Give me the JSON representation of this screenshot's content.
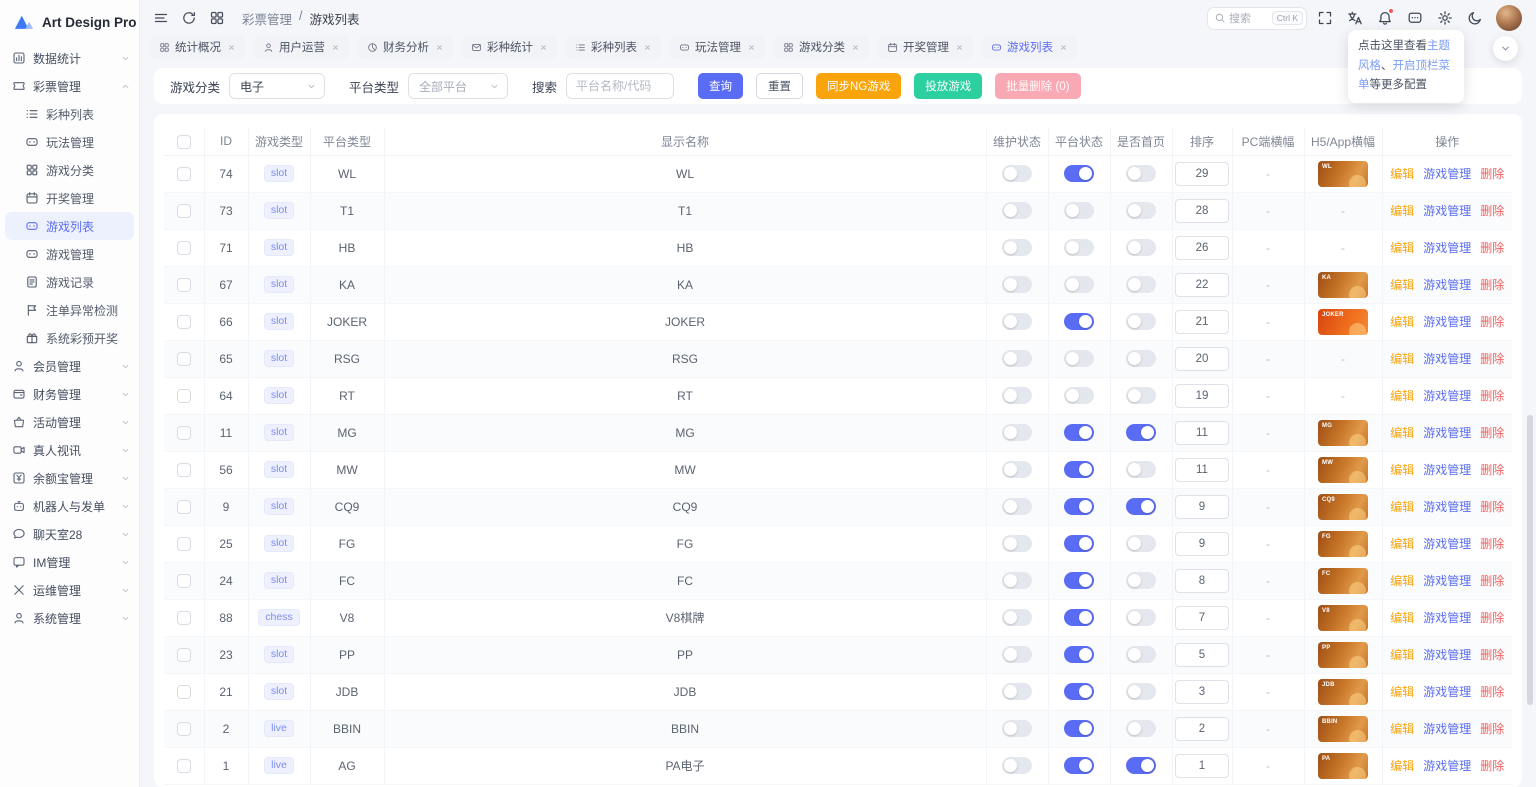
{
  "app": {
    "name": "Art Design Pro"
  },
  "topbar": {
    "breadcrumb": {
      "parent": "彩票管理",
      "separator": "/",
      "current": "游戏列表"
    },
    "search": {
      "placeholder": "搜索",
      "shortcut": "Ctrl K"
    }
  },
  "tooltip": {
    "line1_text": "点击这里查看",
    "line1_link": "主题风格",
    "line1_suffix": "、",
    "line2_link": "开启顶栏菜单",
    "line2_text": "等更多配置"
  },
  "tabs": [
    {
      "key": "stats-overview",
      "label": "统计概况",
      "icon": "grid",
      "active": false
    },
    {
      "key": "user-operation",
      "label": "用户运营",
      "icon": "user",
      "active": false
    },
    {
      "key": "finance-analysis",
      "label": "财务分析",
      "icon": "pie",
      "active": false
    },
    {
      "key": "lottery-stats",
      "label": "彩种统计",
      "icon": "mail",
      "active": false
    },
    {
      "key": "lottery-list",
      "label": "彩种列表",
      "icon": "list",
      "active": false
    },
    {
      "key": "play-manage",
      "label": "玩法管理",
      "icon": "gamepad",
      "active": false
    },
    {
      "key": "game-category",
      "label": "游戏分类",
      "icon": "grid",
      "active": false
    },
    {
      "key": "draw-manage",
      "label": "开奖管理",
      "icon": "calendar",
      "active": false
    },
    {
      "key": "game-list",
      "label": "游戏列表",
      "icon": "gamepad",
      "active": true
    }
  ],
  "sidebar": {
    "items": [
      {
        "key": "stats",
        "label": "数据统计",
        "icon": "bar-chart",
        "expanded": false
      },
      {
        "key": "lottery",
        "label": "彩票管理",
        "icon": "ticket",
        "expanded": true,
        "children": [
          {
            "key": "lottery-list",
            "label": "彩种列表",
            "icon": "list",
            "active": false
          },
          {
            "key": "play-manage",
            "label": "玩法管理",
            "icon": "gamepad",
            "active": false
          },
          {
            "key": "game-category",
            "label": "游戏分类",
            "icon": "grid",
            "active": false
          },
          {
            "key": "draw-manage",
            "label": "开奖管理",
            "icon": "calendar",
            "active": false
          },
          {
            "key": "game-list",
            "label": "游戏列表",
            "icon": "gamepad",
            "active": true
          },
          {
            "key": "game-manage",
            "label": "游戏管理",
            "icon": "gamepad",
            "active": false
          },
          {
            "key": "game-records",
            "label": "游戏记录",
            "icon": "document",
            "active": false
          },
          {
            "key": "bet-anomaly",
            "label": "注单异常检测",
            "icon": "alert-flag",
            "active": false
          },
          {
            "key": "system-predraw",
            "label": "系统彩预开奖",
            "icon": "gift",
            "active": false
          }
        ]
      },
      {
        "key": "members",
        "label": "会员管理",
        "icon": "user",
        "expanded": false
      },
      {
        "key": "finance",
        "label": "财务管理",
        "icon": "wallet",
        "expanded": false
      },
      {
        "key": "activity",
        "label": "活动管理",
        "icon": "activity",
        "expanded": false
      },
      {
        "key": "live-video",
        "label": "真人视讯",
        "icon": "video",
        "expanded": false
      },
      {
        "key": "yuebao",
        "label": "余额宝管理",
        "icon": "yuan",
        "expanded": false
      },
      {
        "key": "robot",
        "label": "机器人与发单",
        "icon": "robot",
        "expanded": false
      },
      {
        "key": "chatroom28",
        "label": "聊天室28",
        "icon": "chat-bubble",
        "expanded": false
      },
      {
        "key": "im",
        "label": "IM管理",
        "icon": "im-chat",
        "expanded": false
      },
      {
        "key": "ops",
        "label": "运维管理",
        "icon": "tools",
        "expanded": false
      },
      {
        "key": "system",
        "label": "系统管理",
        "icon": "system-user",
        "expanded": false
      }
    ]
  },
  "filters": {
    "game_category_label": "游戏分类",
    "game_category_value": "电子",
    "platform_type_label": "平台类型",
    "platform_type_value": "全部平台",
    "search_label": "搜索",
    "search_placeholder": "平台名称/代码",
    "buttons": [
      {
        "key": "query",
        "label": "查询",
        "style": "primary"
      },
      {
        "key": "reset",
        "label": "重置",
        "style": "plain"
      },
      {
        "key": "sync-ng-games",
        "label": "同步NG游戏",
        "style": "warning"
      },
      {
        "key": "deploy-games",
        "label": "投放游戏",
        "style": "success"
      },
      {
        "key": "batch-delete",
        "label": "批量删除 (0)",
        "style": "danger-disabled"
      }
    ]
  },
  "table": {
    "columns": [
      "ID",
      "游戏类型",
      "平台类型",
      "显示名称",
      "维护状态",
      "平台状态",
      "是否首页",
      "排序",
      "PC端横幅",
      "H5/App横幅",
      "操作"
    ],
    "action_labels": {
      "edit": "编辑",
      "manage": "游戏管理",
      "delete": "删除"
    },
    "empty_placeholder": "-",
    "rows": [
      {
        "id": 74,
        "type": "slot",
        "platform": "WL",
        "name": "WL",
        "maintenance": false,
        "platform_status": true,
        "homepage": false,
        "sort": 29,
        "pc_banner": "-",
        "h5_banner": "WL"
      },
      {
        "id": 73,
        "type": "slot",
        "platform": "T1",
        "name": "T1",
        "maintenance": false,
        "platform_status": false,
        "homepage": false,
        "sort": 28,
        "pc_banner": "-",
        "h5_banner": null
      },
      {
        "id": 71,
        "type": "slot",
        "platform": "HB",
        "name": "HB",
        "maintenance": false,
        "platform_status": false,
        "homepage": false,
        "sort": 26,
        "pc_banner": "-",
        "h5_banner": null
      },
      {
        "id": 67,
        "type": "slot",
        "platform": "KA",
        "name": "KA",
        "maintenance": false,
        "platform_status": false,
        "homepage": false,
        "sort": 22,
        "pc_banner": "-",
        "h5_banner": "KA"
      },
      {
        "id": 66,
        "type": "slot",
        "platform": "JOKER",
        "name": "JOKER",
        "maintenance": false,
        "platform_status": true,
        "homepage": false,
        "sort": 21,
        "pc_banner": "-",
        "h5_banner": "JOKER"
      },
      {
        "id": 65,
        "type": "slot",
        "platform": "RSG",
        "name": "RSG",
        "maintenance": false,
        "platform_status": false,
        "homepage": false,
        "sort": 20,
        "pc_banner": "-",
        "h5_banner": null
      },
      {
        "id": 64,
        "type": "slot",
        "platform": "RT",
        "name": "RT",
        "maintenance": false,
        "platform_status": false,
        "homepage": false,
        "sort": 19,
        "pc_banner": "-",
        "h5_banner": null
      },
      {
        "id": 11,
        "type": "slot",
        "platform": "MG",
        "name": "MG",
        "maintenance": false,
        "platform_status": true,
        "homepage": true,
        "sort": 11,
        "pc_banner": "-",
        "h5_banner": "MG"
      },
      {
        "id": 56,
        "type": "slot",
        "platform": "MW",
        "name": "MW",
        "maintenance": false,
        "platform_status": true,
        "homepage": false,
        "sort": 11,
        "pc_banner": "-",
        "h5_banner": "MW"
      },
      {
        "id": 9,
        "type": "slot",
        "platform": "CQ9",
        "name": "CQ9",
        "maintenance": false,
        "platform_status": true,
        "homepage": true,
        "sort": 9,
        "pc_banner": "-",
        "h5_banner": "CQ9"
      },
      {
        "id": 25,
        "type": "slot",
        "platform": "FG",
        "name": "FG",
        "maintenance": false,
        "platform_status": true,
        "homepage": false,
        "sort": 9,
        "pc_banner": "-",
        "h5_banner": "FG"
      },
      {
        "id": 24,
        "type": "slot",
        "platform": "FC",
        "name": "FC",
        "maintenance": false,
        "platform_status": true,
        "homepage": false,
        "sort": 8,
        "pc_banner": "-",
        "h5_banner": "FC"
      },
      {
        "id": 88,
        "type": "chess",
        "platform": "V8",
        "name": "V8棋牌",
        "maintenance": false,
        "platform_status": true,
        "homepage": false,
        "sort": 7,
        "pc_banner": "-",
        "h5_banner": "V8"
      },
      {
        "id": 23,
        "type": "slot",
        "platform": "PP",
        "name": "PP",
        "maintenance": false,
        "platform_status": true,
        "homepage": false,
        "sort": 5,
        "pc_banner": "-",
        "h5_banner": "PP"
      },
      {
        "id": 21,
        "type": "slot",
        "platform": "JDB",
        "name": "JDB",
        "maintenance": false,
        "platform_status": true,
        "homepage": false,
        "sort": 3,
        "pc_banner": "-",
        "h5_banner": "JDB"
      },
      {
        "id": 2,
        "type": "live",
        "platform": "BBIN",
        "name": "BBIN",
        "maintenance": false,
        "platform_status": true,
        "homepage": false,
        "sort": 2,
        "pc_banner": "-",
        "h5_banner": "BBIN"
      },
      {
        "id": 1,
        "type": "live",
        "platform": "AG",
        "name": "PA电子",
        "maintenance": false,
        "platform_status": true,
        "homepage": true,
        "sort": 1,
        "pc_banner": "-",
        "h5_banner": "PA"
      }
    ]
  },
  "colors": {
    "accent": "#5a6cf3",
    "warning": "#f9a40a",
    "success": "#2ccfa0",
    "danger": "#f25f5f"
  }
}
